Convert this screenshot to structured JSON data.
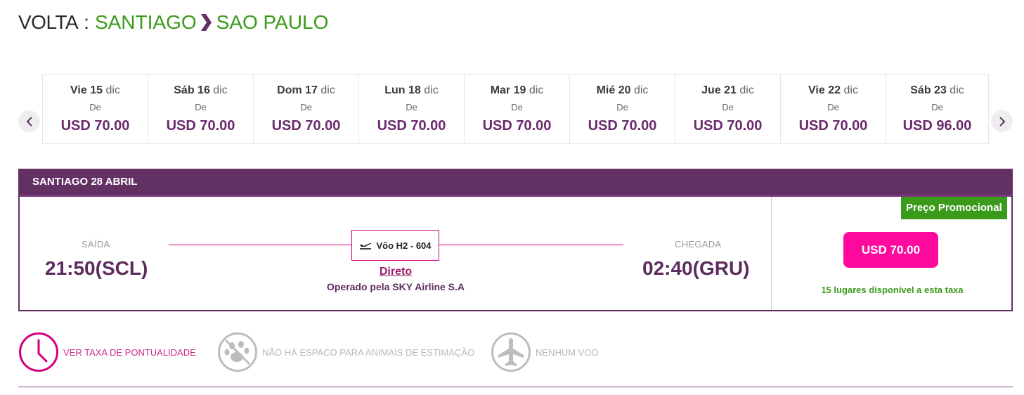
{
  "header": {
    "label": "VOLTA",
    "separator": ":",
    "origin": "SANTIAGO",
    "destination": "SAO PAULO",
    "label_color": "#2b2b2b",
    "city_color": "#3b9a1c"
  },
  "date_strip": {
    "prev_icon": "chevron-left-icon",
    "next_icon": "chevron-right-icon",
    "from_label": "De",
    "dates": [
      {
        "day": "Vie",
        "num": "15",
        "month": "dic",
        "price": "USD 70.00"
      },
      {
        "day": "Sáb",
        "num": "16",
        "month": "dic",
        "price": "USD 70.00"
      },
      {
        "day": "Dom",
        "num": "17",
        "month": "dic",
        "price": "USD 70.00"
      },
      {
        "day": "Lun",
        "num": "18",
        "month": "dic",
        "price": "USD 70.00"
      },
      {
        "day": "Mar",
        "num": "19",
        "month": "dic",
        "price": "USD 70.00"
      },
      {
        "day": "Mié",
        "num": "20",
        "month": "dic",
        "price": "USD 70.00"
      },
      {
        "day": "Jue",
        "num": "21",
        "month": "dic",
        "price": "USD 70.00"
      },
      {
        "day": "Vie",
        "num": "22",
        "month": "dic",
        "price": "USD 70.00"
      },
      {
        "day": "Sáb",
        "num": "23",
        "month": "dic",
        "price": "USD 96.00"
      }
    ]
  },
  "flight": {
    "header": "SANTIAGO 28 ABRIL",
    "departure": {
      "label": "SAÍDA",
      "time": "21:50",
      "airport": "(SCL)"
    },
    "arrival": {
      "label": "CHEGADA",
      "time": "02:40",
      "airport": "(GRU)"
    },
    "flight_number": "Vôo H2 - 604",
    "flight_icon": "plane-takeoff-icon",
    "stops": "Direto",
    "operated_by": "Operado pela SKY Airline S.A",
    "promo_badge": "Preço Promocional",
    "price": "USD 70.00",
    "seats_info": "15 lugares disponível a esta taxa",
    "colors": {
      "primary": "#633064",
      "accent": "#ff0a9e",
      "promo": "#3a9a1a"
    }
  },
  "features": [
    {
      "icon": "clock-icon",
      "label": "VER TAXA DE PONTUALIDADE"
    },
    {
      "icon": "no-pets-icon",
      "label": "NÃO HÁ ESPACO PARA ANIMAIS DE ESTIMAÇÃO"
    },
    {
      "icon": "airplane-icon",
      "label": "NENHUM VOO"
    }
  ]
}
